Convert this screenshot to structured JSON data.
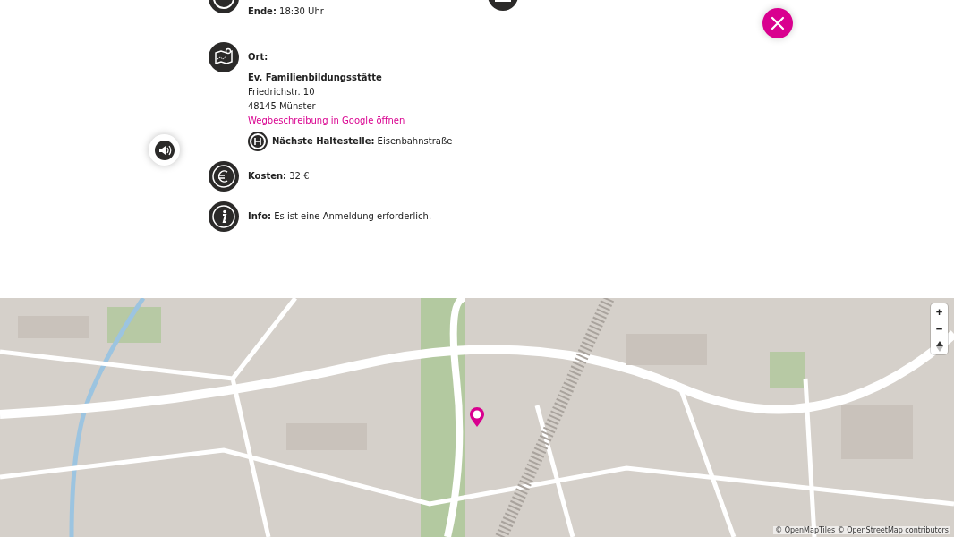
{
  "end": {
    "label": "Ende:",
    "value": "18:30 Uhr"
  },
  "location": {
    "label": "Ort:",
    "name": "Ev. Familienbildungsstätte",
    "street": "Friedrichstr. 10",
    "city": "48145 Münster",
    "directions_link": "Wegbeschreibung in Google öffnen",
    "stop": {
      "label": "Nächste Haltestelle:",
      "value": "Eisenbahnstraße"
    }
  },
  "cost": {
    "label": "Kosten:",
    "value": "32 €"
  },
  "info": {
    "label": "Info:",
    "value": "Es ist eine Anmeldung erforderlich."
  },
  "map": {
    "kind": "picture",
    "zoom_in": "+",
    "zoom_out": "−",
    "attribution": "© OpenMapTiles © OpenStreetMap contributors"
  }
}
